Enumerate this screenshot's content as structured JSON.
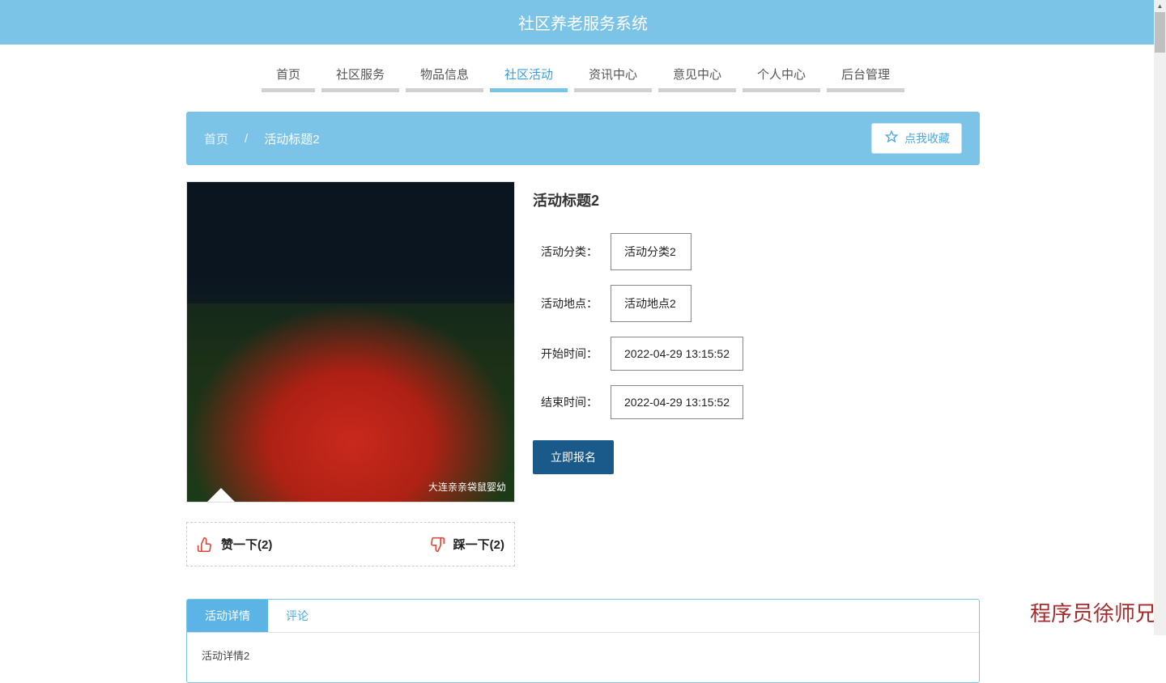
{
  "header": {
    "title": "社区养老服务系统"
  },
  "nav": {
    "items": [
      {
        "label": "首页",
        "active": false
      },
      {
        "label": "社区服务",
        "active": false
      },
      {
        "label": "物品信息",
        "active": false
      },
      {
        "label": "社区活动",
        "active": true
      },
      {
        "label": "资讯中心",
        "active": false
      },
      {
        "label": "意见中心",
        "active": false
      },
      {
        "label": "个人中心",
        "active": false
      },
      {
        "label": "后台管理",
        "active": false
      }
    ]
  },
  "breadcrumb": {
    "home": "首页",
    "sep": "/",
    "current": "活动标题2",
    "favorite_label": "点我收藏"
  },
  "image": {
    "watermark": "大连亲亲袋鼠婴幼"
  },
  "votes": {
    "up_label": "赞一下",
    "up_count": 2,
    "down_label": "踩一下",
    "down_count": 2
  },
  "detail": {
    "title": "活动标题2",
    "fields": [
      {
        "label": "活动分类",
        "value": "活动分类2"
      },
      {
        "label": "活动地点",
        "value": "活动地点2"
      },
      {
        "label": "开始时间",
        "value": "2022-04-29 13:15:52"
      },
      {
        "label": "结束时间",
        "value": "2022-04-29 13:15:52"
      }
    ],
    "signup_label": "立即报名"
  },
  "tabs": {
    "items": [
      {
        "label": "活动详情",
        "active": true
      },
      {
        "label": "评论",
        "active": false
      }
    ],
    "content": "活动详情2"
  },
  "watermark": "程序员徐师兄"
}
